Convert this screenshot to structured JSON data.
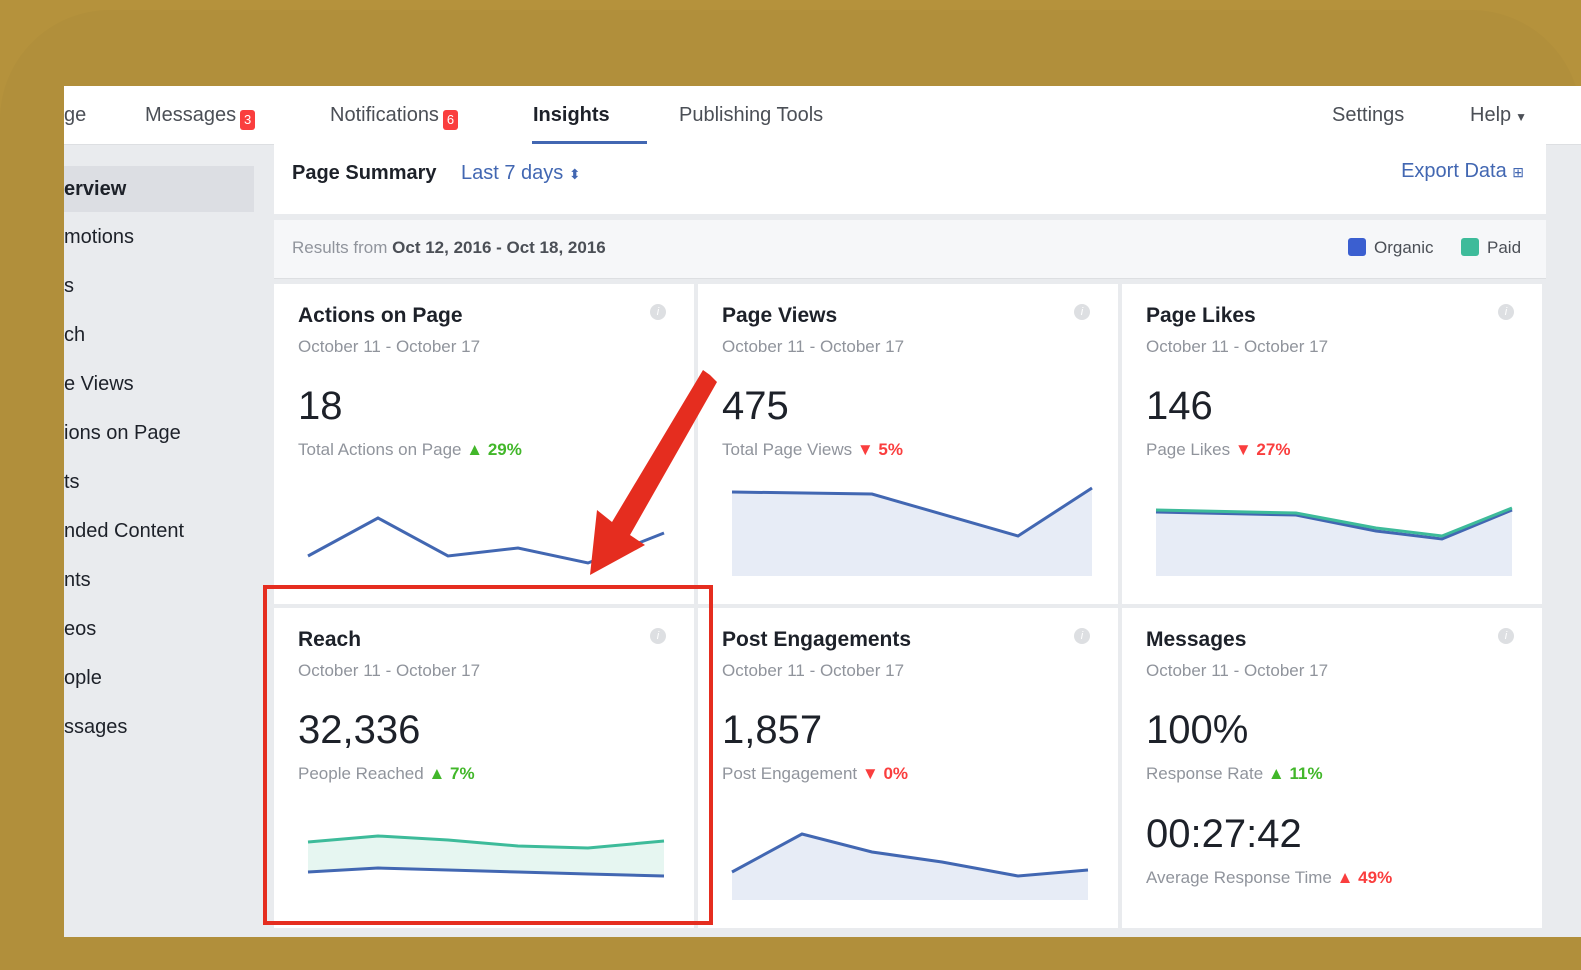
{
  "nav": {
    "items": [
      {
        "label": "ge"
      },
      {
        "label": "Messages",
        "badge": "3"
      },
      {
        "label": "Notifications",
        "badge": "6"
      },
      {
        "label": "Insights",
        "active": true
      },
      {
        "label": "Publishing Tools"
      }
    ],
    "settings": "Settings",
    "help": "Help"
  },
  "sidebar": {
    "items": [
      {
        "label": "erview",
        "active": true
      },
      {
        "label": "motions"
      },
      {
        "label": "s"
      },
      {
        "label": "ch"
      },
      {
        "label": "e Views"
      },
      {
        "label": "ions on Page"
      },
      {
        "label": "ts"
      },
      {
        "label": "nded Content"
      },
      {
        "label": "nts"
      },
      {
        "label": "eos"
      },
      {
        "label": "ople"
      },
      {
        "label": "ssages"
      }
    ]
  },
  "summary": {
    "title": "Page Summary",
    "range": "Last 7 days",
    "export": "Export Data",
    "results_prefix": "Results from",
    "results_range": "Oct 12, 2016 - Oct 18, 2016",
    "legend_organic": "Organic",
    "legend_paid": "Paid"
  },
  "colors": {
    "organic": "#3b5fd0",
    "paid": "#3dbb9a",
    "highlight": "#e52d1f"
  },
  "cards": [
    {
      "title": "Actions on Page",
      "date": "October 11 - October 17",
      "value": "18",
      "sub": "Total Actions on Page",
      "delta": "29%",
      "dir": "up"
    },
    {
      "title": "Page Views",
      "date": "October 11 - October 17",
      "value": "475",
      "sub": "Total Page Views",
      "delta": "5%",
      "dir": "down"
    },
    {
      "title": "Page Likes",
      "date": "October 11 - October 17",
      "value": "146",
      "sub": "Page Likes",
      "delta": "27%",
      "dir": "down"
    },
    {
      "title": "Reach",
      "date": "October 11 - October 17",
      "value": "32,336",
      "sub": "People Reached",
      "delta": "7%",
      "dir": "up"
    },
    {
      "title": "Post Engagements",
      "date": "October 11 - October 17",
      "value": "1,857",
      "sub": "Post Engagement",
      "delta": "0%",
      "dir": "down"
    },
    {
      "title": "Messages",
      "date": "October 11 - October 17",
      "value": "100%",
      "sub": "Response Rate",
      "delta": "11%",
      "dir": "up",
      "value2": "00:27:42",
      "sub2": "Average Response Time",
      "delta2": "49%",
      "dir2": "up"
    }
  ]
}
